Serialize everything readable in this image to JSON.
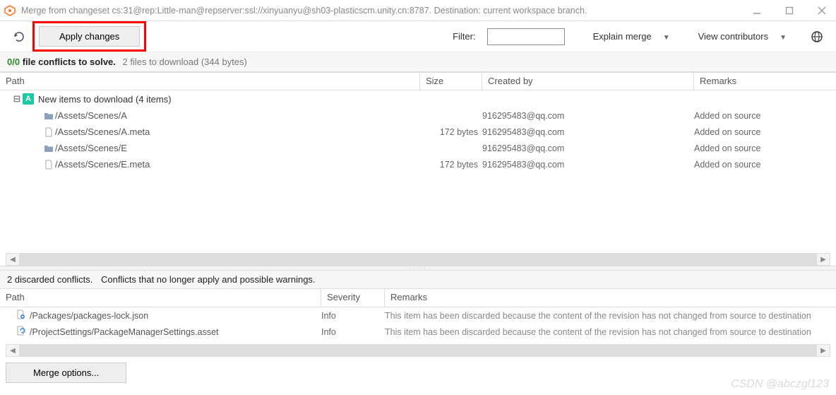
{
  "window": {
    "title": "Merge from changeset cs:31@rep:Little-man@repserver:ssl://xinyuanyu@sh03-plasticscm.unity.cn:8787. Destination: current workspace branch."
  },
  "toolbar": {
    "apply_label": "Apply changes",
    "filter_label": "Filter:",
    "filter_value": "",
    "explain_merge": "Explain merge",
    "view_contributors": "View contributors"
  },
  "banner": {
    "conflict_count": "0/0",
    "conflict_text": "file conflicts to solve.",
    "download_text": "2 files to download (344 bytes)"
  },
  "columns": {
    "path": "Path",
    "size": "Size",
    "created_by": "Created by",
    "remarks": "Remarks"
  },
  "group": {
    "label": "New items to download (4 items)"
  },
  "rows": [
    {
      "type": "folder",
      "path": "/Assets/Scenes/A",
      "size": "",
      "created_by": "916295483@qq.com",
      "remarks": "Added on source"
    },
    {
      "type": "file",
      "path": "/Assets/Scenes/A.meta",
      "size": "172 bytes",
      "created_by": "916295483@qq.com",
      "remarks": "Added on source"
    },
    {
      "type": "folder",
      "path": "/Assets/Scenes/E",
      "size": "",
      "created_by": "916295483@qq.com",
      "remarks": "Added on source"
    },
    {
      "type": "file",
      "path": "/Assets/Scenes/E.meta",
      "size": "172 bytes",
      "created_by": "916295483@qq.com",
      "remarks": "Added on source"
    }
  ],
  "discarded": {
    "count_text": "2 discarded conflicts.",
    "desc": "Conflicts that no longer apply and possible warnings."
  },
  "columns2": {
    "path": "Path",
    "severity": "Severity",
    "remarks": "Remarks"
  },
  "drows": [
    {
      "icon": "file-lock",
      "path": "/Packages/packages-lock.json",
      "severity": "Info",
      "remarks": "This item has been discarded because the content of the revision has not changed from source to destination"
    },
    {
      "icon": "file-sync",
      "path": "/ProjectSettings/PackageManagerSettings.asset",
      "severity": "Info",
      "remarks": "This item has been discarded because the content of the revision has not changed from source to destination"
    }
  ],
  "bottom": {
    "merge_options": "Merge options..."
  },
  "watermark": "CSDN @abczgl123"
}
